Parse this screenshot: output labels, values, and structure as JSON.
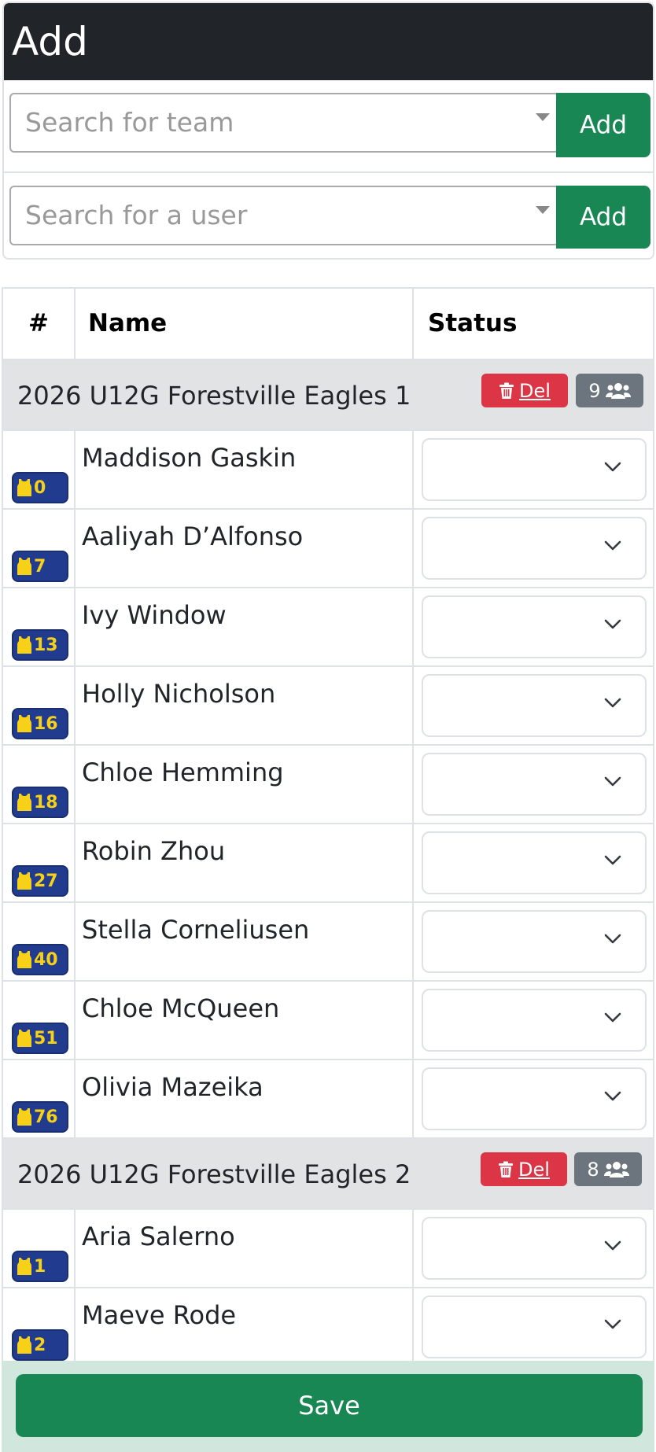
{
  "add": {
    "title": "Add",
    "team_search_placeholder": "Search for team",
    "user_search_placeholder": "Search for a user",
    "add_label": "Add"
  },
  "table": {
    "headers": {
      "num": "#",
      "name": "Name",
      "status": "Status"
    }
  },
  "groups": [
    {
      "name": "2026 U12G Forestville Eagles 1",
      "del_label": "Del",
      "count": "9",
      "players": [
        {
          "number": "0",
          "name": "Maddison Gaskin"
        },
        {
          "number": "7",
          "name": "Aaliyah D’Alfonso"
        },
        {
          "number": "13",
          "name": "Ivy Window"
        },
        {
          "number": "16",
          "name": "Holly Nicholson"
        },
        {
          "number": "18",
          "name": "Chloe Hemming"
        },
        {
          "number": "27",
          "name": "Robin Zhou"
        },
        {
          "number": "40",
          "name": "Stella Corneliusen"
        },
        {
          "number": "51",
          "name": "Chloe McQueen"
        },
        {
          "number": "76",
          "name": "Olivia Mazeika"
        }
      ]
    },
    {
      "name": "2026 U12G Forestville Eagles 2",
      "del_label": "Del",
      "count": "8",
      "players": [
        {
          "number": "1",
          "name": "Aria Salerno"
        },
        {
          "number": "2",
          "name": "Maeve Rode"
        }
      ]
    }
  ],
  "footer": {
    "save_label": "Save"
  },
  "colors": {
    "header_bg": "#212529",
    "add_button": "#198754",
    "delete": "#dc3545",
    "count_badge": "#6c757d",
    "jersey_bg": "#213c8f",
    "jersey_fg": "#f7d117",
    "footer_bg": "#d1e7dd"
  }
}
